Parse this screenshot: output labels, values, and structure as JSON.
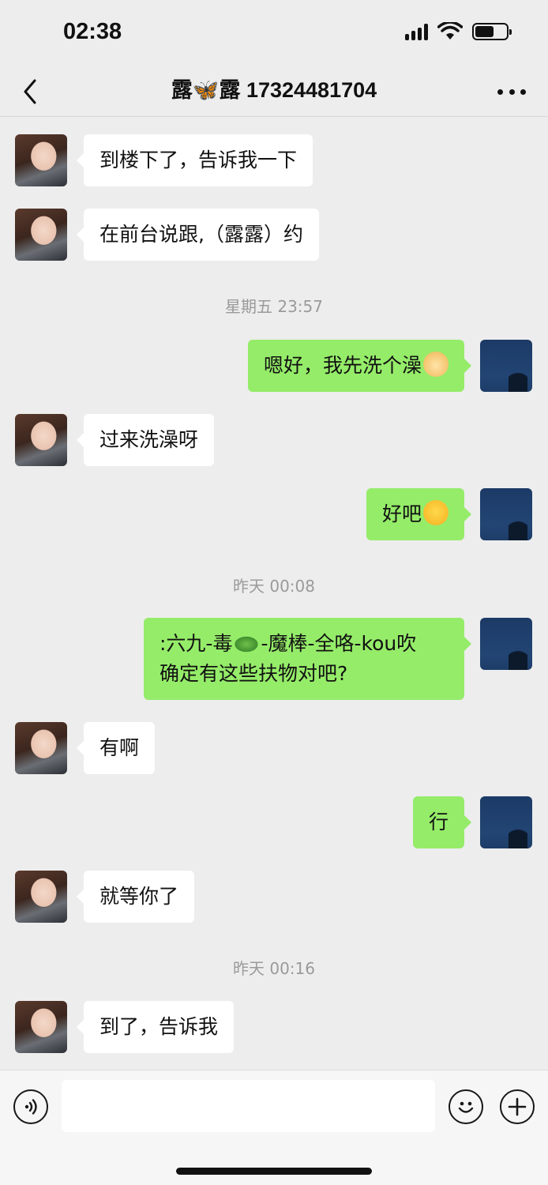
{
  "status_bar": {
    "time": "02:38",
    "battery_level_pct": 60
  },
  "nav": {
    "title": "露🦋露 17324481704",
    "back_icon": "chevron-left-icon",
    "more_icon": "more-dots-icon"
  },
  "messages": [
    {
      "kind": "in",
      "text": "到楼下了，告诉我一下"
    },
    {
      "kind": "in",
      "text": "在前台说跟,（露露）约"
    },
    {
      "kind": "time",
      "text": "星期五 23:57"
    },
    {
      "kind": "out",
      "text": "嗯好，我先洗个澡",
      "emoji": "doge-emoji"
    },
    {
      "kind": "in",
      "text": "过来洗澡呀"
    },
    {
      "kind": "out",
      "text": "好吧",
      "emoji": "laugh-cry-emoji"
    },
    {
      "kind": "time",
      "text": "昨天 00:08"
    },
    {
      "kind": "out",
      "line1a": ":六九-毒",
      "emoji": "crocodile-emoji",
      "line1b": "-魔棒-全咯-kou吹",
      "line2": "确定有这些扶物对吧?"
    },
    {
      "kind": "in",
      "text": "有啊"
    },
    {
      "kind": "out",
      "text": "行"
    },
    {
      "kind": "in",
      "text": "就等你了"
    },
    {
      "kind": "time",
      "text": "昨天 00:16"
    },
    {
      "kind": "in",
      "text": "到了，告诉我"
    }
  ],
  "input_bar": {
    "voice_icon": "voice-icon",
    "emoji_icon": "emoji-smile-icon",
    "plus_icon": "plus-icon",
    "input_value": ""
  },
  "colors": {
    "background": "#ededed",
    "outgoing_bubble": "#95ec69",
    "incoming_bubble": "#ffffff"
  }
}
